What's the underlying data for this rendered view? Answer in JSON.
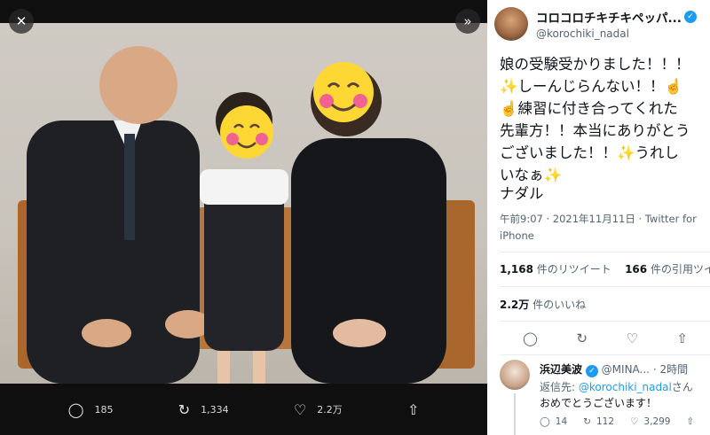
{
  "viewer": {
    "close_icon": "close-icon",
    "expand_icon": "chevron-double-right-icon",
    "actions": [
      {
        "icon": "reply-icon",
        "glyph": "◯",
        "count": "185"
      },
      {
        "icon": "retweet-icon",
        "glyph": "↻",
        "count": "1,334"
      },
      {
        "icon": "like-icon",
        "glyph": "♡",
        "count": "2.2万"
      },
      {
        "icon": "share-icon",
        "glyph": "⇧",
        "count": ""
      }
    ]
  },
  "tweet": {
    "author": {
      "name": "コロコロチキチキペッパ...",
      "handle": "@korochiki_nadal"
    },
    "text": "娘の受験受かりました！！！\n✨しーんじらんない！！☝️\n☝️練習に付き合ってくれた\n先輩方！！本当にありがとう\nございました！！✨うれし\nいなぁ✨",
    "signature": "ナダル",
    "timestamp": "午前9:07 · 2021年11月11日 · Twitter for iPhone",
    "retweets_count": "1,168",
    "retweets_label": "件のリツイート",
    "quotes_count": "166",
    "quotes_label": "件の引用ツイート",
    "likes_count": "2.2万",
    "likes_label": "件のいいね",
    "actions": [
      {
        "icon": "reply-icon",
        "glyph": "◯"
      },
      {
        "icon": "retweet-icon",
        "glyph": "↻"
      },
      {
        "icon": "like-icon",
        "glyph": "♡"
      },
      {
        "icon": "share-icon",
        "glyph": "⇧"
      }
    ]
  },
  "reply": {
    "name": "浜辺美波",
    "handle": "@MINA...",
    "time": "· 2時間",
    "reply_to_label": "返信先: ",
    "reply_to_handle": "@korochiki_nadal",
    "reply_to_suffix": "さん",
    "text": "おめでとうございます！",
    "actions": [
      {
        "icon": "reply-icon",
        "glyph": "◯",
        "count": "14"
      },
      {
        "icon": "retweet-icon",
        "glyph": "↻",
        "count": "112"
      },
      {
        "icon": "like-icon",
        "glyph": "♡",
        "count": "3,299"
      },
      {
        "icon": "share-icon",
        "glyph": "⇧",
        "count": ""
      }
    ]
  }
}
